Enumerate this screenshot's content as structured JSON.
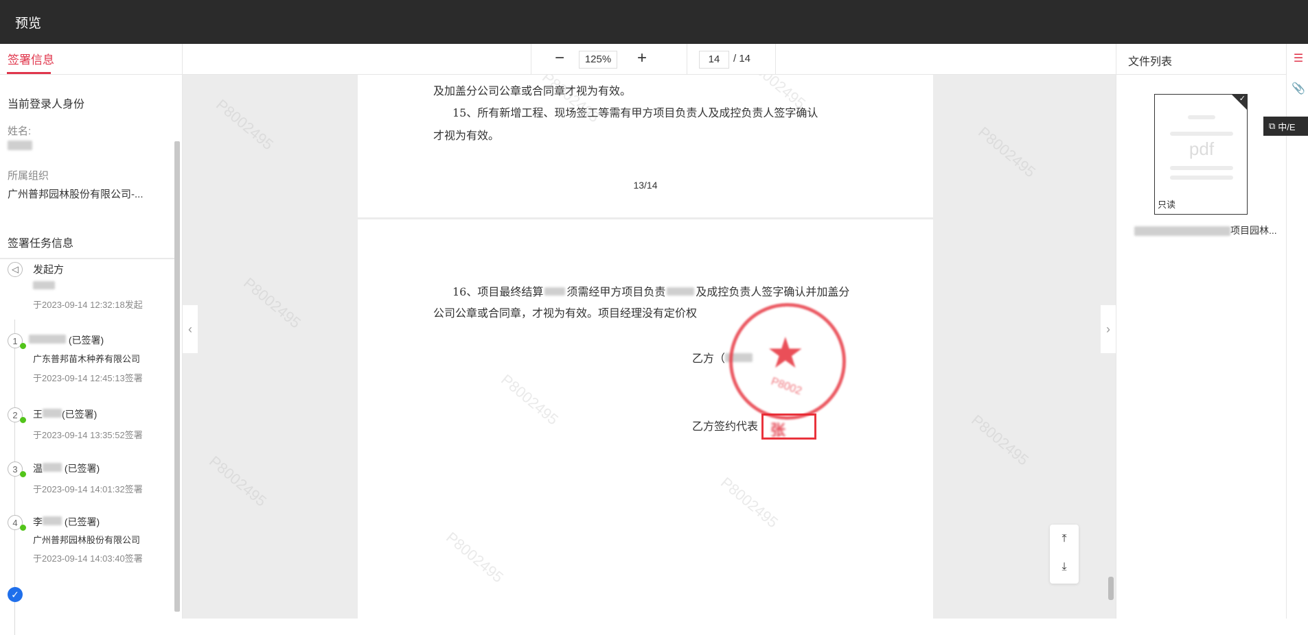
{
  "header": {
    "title": "预览"
  },
  "left_panel": {
    "tab_label": "签署信息",
    "identity_title": "当前登录人身份",
    "name_label": "姓名:",
    "org_label": "所属组织",
    "org_value": "广州普邦园林股份有限公司-...",
    "task_title": "签署任务信息",
    "timeline": [
      {
        "node": "",
        "name": "发起方",
        "org": "",
        "time": "于2023-09-14 12:32:18发起"
      },
      {
        "node": "1",
        "name": "(已签署)",
        "org": "广东普邦苗木种养有限公司",
        "time": "于2023-09-14 12:45:13签署"
      },
      {
        "node": "2",
        "name": "王",
        "status": "(已签署)",
        "org": "",
        "time": "于2023-09-14 13:35:52签署"
      },
      {
        "node": "3",
        "name": "温",
        "status": "(已签署)",
        "org": "",
        "time": "于2023-09-14 14:01:32签署"
      },
      {
        "node": "4",
        "name": "李",
        "status": "(已签署)",
        "org": "广州普邦园林股份有限公司",
        "time": "于2023-09-14 14:03:40签署"
      }
    ]
  },
  "toolbar": {
    "zoom_out": "−",
    "zoom_value": "125%",
    "zoom_in": "+",
    "page_current": "14",
    "page_total": "/ 14"
  },
  "document": {
    "p1_line1": "及加盖分公司公章或合同章才视为有效。",
    "p1_line2": "15、所有新增工程、现场签工等需有甲方项目负责人及成控负责人签字确认",
    "p1_line3": "才视为有效。",
    "p1_page_num": "13/14",
    "p2_line1": "16、项目最终结算",
    "p2_line1b": "须需经甲方项目负责",
    "p2_line1c": "及成控负责人签字确认并加盖分",
    "p2_line2": "公司公章或合同章，才视为有效。项目经理没有定价权",
    "party_b": "乙方（",
    "party_b_rep": "乙方签约代表",
    "stamp_code": "P8002",
    "signature": "张"
  },
  "right_panel": {
    "title": "文件列表",
    "file": {
      "ext": "pdf",
      "badge": "只读",
      "name_suffix": "项目园林..."
    }
  },
  "rail": {
    "lang": "中/E"
  }
}
